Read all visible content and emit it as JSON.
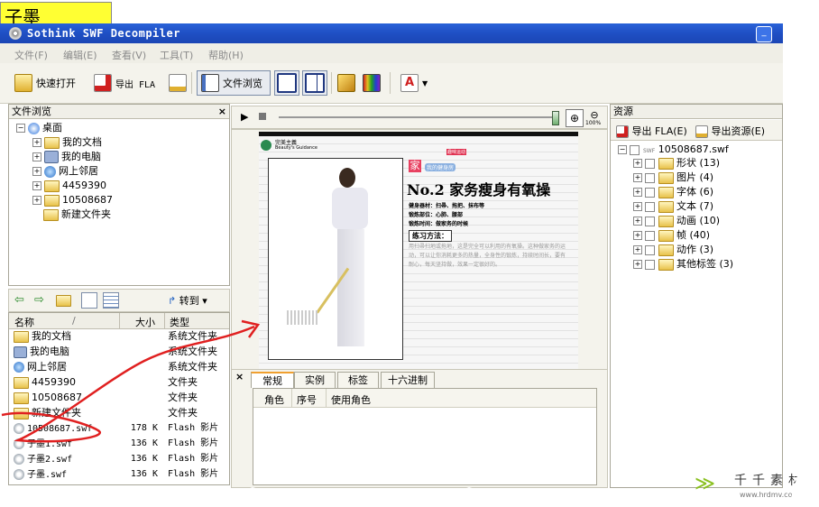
{
  "logo": {
    "text": "子墨"
  },
  "window": {
    "title": "Sothink SWF Decompiler",
    "minimize_label": "_"
  },
  "menu": [
    {
      "label": "文件(F)"
    },
    {
      "label": "编辑(E)"
    },
    {
      "label": "查看(V)"
    },
    {
      "label": "工具(T)"
    },
    {
      "label": "帮助(H)"
    }
  ],
  "toolbar": {
    "quick_open": "快速打开",
    "export_fla": "导出 FLA",
    "file_browse": "文件浏览",
    "text_icon": "A"
  },
  "file_browser": {
    "title": "文件浏览",
    "close": "×",
    "tree": [
      {
        "label": "桌面"
      },
      {
        "label": "我的文档"
      },
      {
        "label": "我的电脑"
      },
      {
        "label": "网上邻居"
      },
      {
        "label": "4459390"
      },
      {
        "label": "10508687"
      },
      {
        "label": "新建文件夹"
      }
    ],
    "goto_label": "转到",
    "columns": {
      "name": "名称",
      "sort_mark": "/",
      "size": "大小",
      "type": "类型"
    },
    "rows": [
      {
        "name": "我的文档",
        "size": "",
        "type": "系统文件夹"
      },
      {
        "name": "我的电脑",
        "size": "",
        "type": "系统文件夹"
      },
      {
        "name": "网上邻居",
        "size": "",
        "type": "系统文件夹"
      },
      {
        "name": "4459390",
        "size": "",
        "type": "文件夹"
      },
      {
        "name": "10508687",
        "size": "",
        "type": "文件夹"
      },
      {
        "name": "新建文件夹",
        "size": "",
        "type": "文件夹"
      },
      {
        "name": "10508687.swf",
        "size": "178 K",
        "type": "Flash 影片"
      },
      {
        "name": "子墨1.swf",
        "size": "136 K",
        "type": "Flash 影片"
      },
      {
        "name": "子墨2.swf",
        "size": "136 K",
        "type": "Flash 影片"
      },
      {
        "name": "子墨.swf",
        "size": "136 K",
        "type": "Flash 影片"
      }
    ]
  },
  "preview": {
    "zoom_label": "100%",
    "ad": {
      "brand_cn": "完美主義",
      "brand_en": "Beauty's Guidance",
      "badge": "家",
      "badge_tag": "我的健身房",
      "badge_hot": "趣味运动",
      "headline": "No.2 家务瘦身有氧操",
      "line1": "健身器材：扫帚、拖把、抹布等",
      "line2": "锻炼部位：心肺、腰部",
      "line3": "锻炼时间：做家务的时候",
      "method_label": "练习方法：",
      "body": "用扫帚扫地或拖地，这是完全可以利用的有氧操。这种做家务的运动，可以让你消耗更多的热量，全身性的锻炼，持续时间长，要有耐心，每天坚持做，效果一定很好的。"
    }
  },
  "properties": {
    "close": "×",
    "tabs": [
      {
        "label": "常规"
      },
      {
        "label": "实例"
      },
      {
        "label": "标签"
      },
      {
        "label": "十六进制"
      }
    ],
    "columns": [
      "角色",
      "序号",
      "使用角色"
    ]
  },
  "resources": {
    "title": "资源",
    "export_fla": "导出 FLA(E)",
    "export_res": "导出资源(E)",
    "root_tag": "SWF",
    "root": "10508687.swf",
    "items": [
      {
        "label": "形状",
        "count": "(13)"
      },
      {
        "label": "图片",
        "count": "(4)"
      },
      {
        "label": "字体",
        "count": "(6)"
      },
      {
        "label": "文本",
        "count": "(7)"
      },
      {
        "label": "动画",
        "count": "(10)"
      },
      {
        "label": "帧",
        "count": "(40)"
      },
      {
        "label": "动作",
        "count": "(3)"
      },
      {
        "label": "其他标签",
        "count": "(3)"
      }
    ]
  },
  "watermark": {
    "title": "千千素材",
    "url": "www.hrdmv.com"
  },
  "colors": {
    "titlebar": "#1f4fc4",
    "logo_bg": "#ffff33",
    "annotation": "#e02020",
    "accent": "#f0a030"
  }
}
